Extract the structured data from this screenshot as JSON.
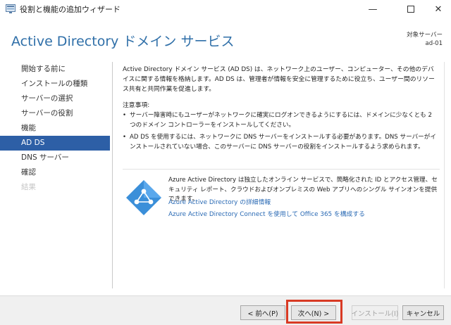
{
  "window": {
    "title": "役割と機能の追加ウィザード",
    "min_glyph": "—",
    "close_glyph": "✕"
  },
  "header": {
    "title": "Active Directory ドメイン サービス",
    "target_label": "対象サーバー",
    "target_server": "ad-01"
  },
  "nav": {
    "items": [
      {
        "label": "開始する前に",
        "state": "normal"
      },
      {
        "label": "インストールの種類",
        "state": "normal"
      },
      {
        "label": "サーバーの選択",
        "state": "normal"
      },
      {
        "label": "サーバーの役割",
        "state": "normal"
      },
      {
        "label": "機能",
        "state": "normal"
      },
      {
        "label": "AD DS",
        "state": "active"
      },
      {
        "label": "DNS サーバー",
        "state": "normal"
      },
      {
        "label": "確認",
        "state": "normal"
      },
      {
        "label": "結果",
        "state": "disabled"
      }
    ]
  },
  "content": {
    "intro": "Active Directory ドメイン サービス (AD DS) は、ネットワーク上のユーザー、コンピューター、その他のデバイスに関する情報を格納します。AD DS は、管理者が情報を安全に管理するために役立ち、ユーザー間のリソース共有と共同作業を促進します。",
    "notes_heading": "注意事項:",
    "notes": [
      "サーバー障害時にもユーザーがネットワークに確実にログオンできるようにするには、ドメインに少なくとも 2 つのドメイン コントローラーをインストールしてください。",
      "AD DS を使用するには、ネットワークに DNS サーバーをインストールする必要があります。DNS サーバーがインストールされていない場合、このサーバーに DNS サーバーの役割をインストールするよう求められます。"
    ],
    "azure_text": "Azure Active Directory は独立したオンライン サービスで、簡略化された ID とアクセス管理、セキュリティ レポート、クラウドおよびオンプレミスの Web アプリへのシングル サインオンを提供できます。",
    "link_details": "Azure Active Directory の詳細情報",
    "link_connect": "Azure Active Directory Connect を使用して Office 365 を構成する"
  },
  "buttons": {
    "prev": "< 前へ(P)",
    "next": "次へ(N) >",
    "install": "インストール(I)",
    "cancel": "キャンセル"
  },
  "colors": {
    "accent": "#2d5fa6",
    "title": "#2f6fa8",
    "link": "#2a6ab4",
    "highlight": "#d83a24",
    "azure_icon": "#3b8fd9"
  }
}
